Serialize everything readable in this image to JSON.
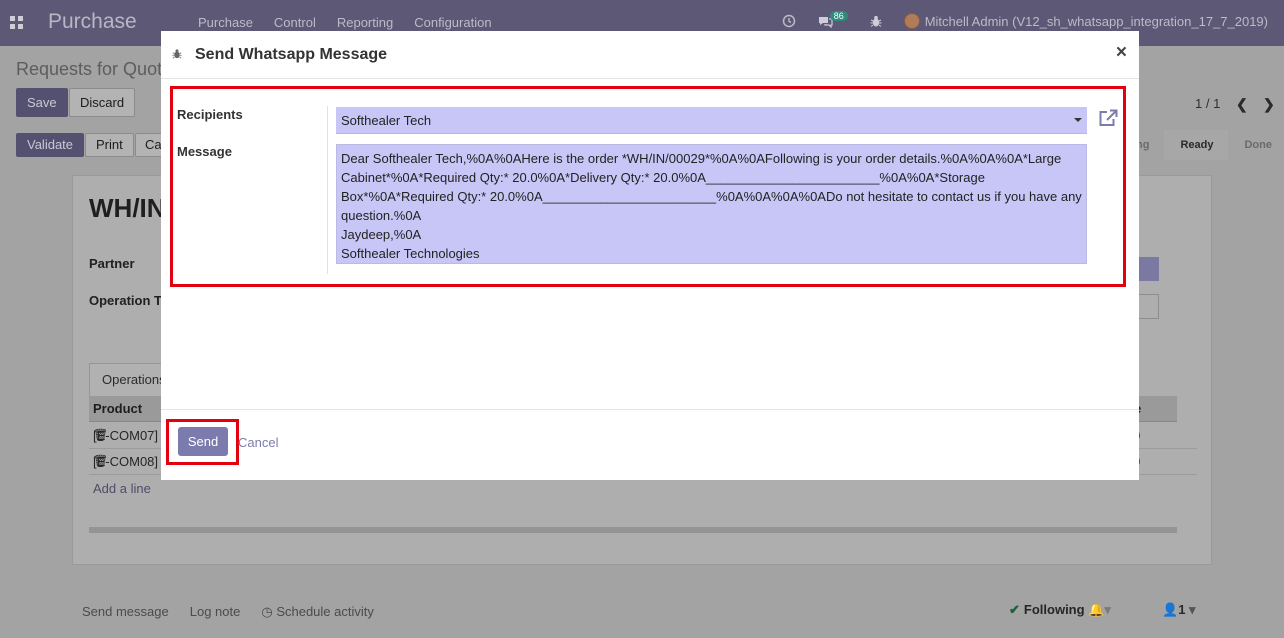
{
  "navbar": {
    "brand": "Purchase",
    "menu": [
      "Purchase",
      "Control",
      "Reporting",
      "Configuration"
    ],
    "messages_count": "86",
    "user": "Mitchell Admin (V12_sh_whatsapp_integration_17_7_2019)"
  },
  "page": {
    "breadcrumb": "Requests for Quot",
    "save_label": "Save",
    "discard_label": "Discard",
    "pager": "1 / 1",
    "validate_label": "Validate",
    "print_label": "Print",
    "cancel_label": "Ca",
    "status_steps": [
      "Ready",
      "Done"
    ],
    "status_partial": "ng",
    "record_title": "WH/IN",
    "partner_label": "Partner",
    "operation_label": "Operation T",
    "tab_operations": "Operations",
    "column_product": "Product",
    "rows": [
      "[E-COM07]",
      "[E-COM08]"
    ],
    "add_line": "Add a line",
    "col_partial": "e",
    "cell_partial": [
      "0",
      "0"
    ]
  },
  "chatter": {
    "send_message": "Send message",
    "log_note": "Log note",
    "schedule_activity": "Schedule activity",
    "following": "Following",
    "followers_count": "1"
  },
  "modal": {
    "title": "Send Whatsapp Message",
    "close": "×",
    "recipients_label": "Recipients",
    "recipients_value": "Softhealer Tech",
    "message_label": "Message",
    "message_text": "Dear Softhealer Tech,%0A%0AHere is the order *WH/IN/00029*%0A%0AFollowing is your order details.%0A%0A%0A*Large Cabinet*%0A*Required Qty:* 20.0%0A*Delivery Qty:* 20.0%0A________________________%0A%0A*Storage Box*%0A*Required Qty:* 20.0%0A________________________%0A%0A%0A%0ADo not hesitate to contact us if you have any question.%0A\nJaydeep,%0A\nSofthealer Technologies",
    "send_label": "Send",
    "cancel_label": "Cancel"
  },
  "colors": {
    "navbar": "#5c5875",
    "highlight": "#e3000f",
    "field_bg": "#c8c6f7",
    "primary_button": "#7c7bad"
  }
}
